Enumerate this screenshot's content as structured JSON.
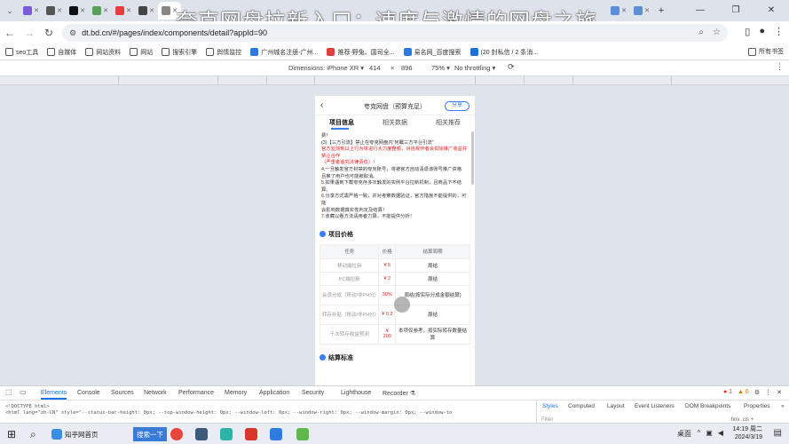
{
  "overlay_title": "夸克网盘拉新入口：速度与激情的网盘之旅",
  "tabs": [
    {
      "fav_color": "#7b5cd6"
    },
    {
      "fav_color": "#555555"
    },
    {
      "fav_color": "#111111"
    },
    {
      "fav_color": "#5aa05a"
    },
    {
      "fav_color": "#e04040"
    },
    {
      "fav_color": "#444444"
    },
    {
      "fav_color": "#888888"
    }
  ],
  "window_controls": {
    "min": "—",
    "max": "❐",
    "close": "✕"
  },
  "address": {
    "url": "dt.bd.cn/#/pages/index/components/detail?appId=90"
  },
  "bookmarks": [
    {
      "label": "seo工具",
      "color": "#333"
    },
    {
      "label": "自媒体",
      "color": "#333"
    },
    {
      "label": "网站资料",
      "color": "#333"
    },
    {
      "label": "网站",
      "color": "#333"
    },
    {
      "label": "搜索引擎",
      "color": "#333"
    },
    {
      "label": "舆情监控",
      "color": "#333"
    },
    {
      "label": "广州城名注册-广州...",
      "color": "#2a7ae2"
    },
    {
      "label": "推荐-野兔、国司全...",
      "color": "#e04040"
    },
    {
      "label": "易名网_百度搜索",
      "color": "#2a7ae2"
    },
    {
      "label": "(20 封私信 / 2 条消...",
      "color": "#1a6fd8"
    }
  ],
  "bookmarks_all": "所有书签",
  "device_bar": {
    "dimensions": "Dimensions: iPhone XR ▾",
    "width": "414",
    "times": "×",
    "height": "896",
    "zoom": "75% ▾",
    "throttle": "No throttling ▾"
  },
  "phone": {
    "title": "夸克网盘（预算充足）",
    "share": "分享",
    "tabs": [
      "项目信息",
      "相关数据",
      "相关推荐"
    ],
    "rules_lines": [
      {
        "text": "费！",
        "red": false
      },
      {
        "text": "(3)【三方引流】禁止在夸克网盘内“何瞩三方平台引流”",
        "red": false
      },
      {
        "text": "官方监测到以上行为将进行大力度整顿，对违规作者会扣除推广收益并禁止合作",
        "red": true
      },
      {
        "text": "（严重者追究法律责任）！",
        "red": true
      },
      {
        "text": "4.一旦触发官方封禁的夸克账号，将被官方自动清退该账号推广资格",
        "red": false
      },
      {
        "text": "且推了用户也可能被取消。",
        "red": false
      },
      {
        "text": "5.如果遇到下载夸克存多次触发的实例平台拉新机制，且商品下不结",
        "red": false
      },
      {
        "text": "算。",
        "red": false
      },
      {
        "text": "6.分享方式需严格一致，并对考察数据验证，官方措施不能提供的，可能",
        "red": false
      },
      {
        "text": "会影响数据真实性判定及结算！",
        "red": false
      },
      {
        "text": "7.收藏以看方法请用者力算，不能提供分析！",
        "red": false
      }
    ],
    "price_section_title": "项目价格",
    "table_headers": [
      "任务",
      "价格",
      "结算周期"
    ],
    "table_rows": [
      {
        "task": "移动端拉新",
        "price": "¥ 5",
        "cycle": "周结"
      },
      {
        "task": "PC端拉新",
        "price": "¥ 2",
        "cycle": "周结"
      },
      {
        "task": "会员分成（移动/非PH分）",
        "price": "30%",
        "cycle": "周结(按实际分成金额结算)"
      },
      {
        "task": "转存补贴（移动/非PH分）",
        "price": "¥ 0.2",
        "cycle": "周结"
      },
      {
        "task": "千次转存收益预测",
        "price": "¥ 200",
        "cycle": "本项仅参考，按实际转存数量结算"
      }
    ],
    "settle_section_title": "结算标准"
  },
  "devtools": {
    "tabs": [
      "Elements",
      "Console",
      "Sources",
      "Network",
      "Performance",
      "Memory",
      "Application",
      "Security",
      "Lighthouse",
      "Recorder ⚗"
    ],
    "errors": "● 1",
    "warnings": "▲ 6",
    "code_line1": "<!DOCTYPE html>",
    "code_line2": "<html lang=\"zh-CN\" style=\"--status-bar-height: 0px; --top-window-height: 0px; --window-left: 0px; --window-right: 0px; --window-margin: 0px; --window-to",
    "styles_tabs": [
      "Styles",
      "Computed",
      "Layout",
      "Event Listeners",
      "DOM Breakpoints",
      "Properties",
      "»"
    ],
    "filter_placeholder": "Filter",
    "filter_right": ":hov .cls +"
  },
  "taskbar": {
    "search_label": "知乎网首页",
    "app_label": "搜索一下",
    "tray_label": "桌面",
    "time": "14:19 周二",
    "date": "2024/3/19"
  }
}
